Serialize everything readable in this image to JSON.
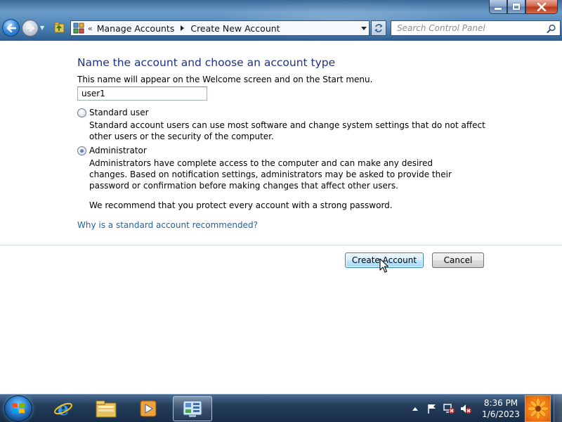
{
  "window": {
    "breadcrumb": {
      "overflow_glyph": "«",
      "items": [
        "Manage Accounts",
        "Create New Account"
      ]
    },
    "search": {
      "placeholder": "Search Control Panel"
    },
    "controls": [
      "minimize",
      "maximize",
      "close"
    ]
  },
  "page": {
    "heading": "Name the account and choose an account type",
    "subtext": "This name will appear on the Welcome screen and on the Start menu.",
    "account_name": "user1",
    "options": {
      "standard": {
        "label": "Standard user",
        "description": "Standard account users can use most software and change system settings that do not affect other users or the security of the computer.",
        "selected": false
      },
      "administrator": {
        "label": "Administrator",
        "description": "Administrators have complete access to the computer and can make any desired changes. Based on notification settings, administrators may be asked to provide their password or confirmation before making changes that affect other users.",
        "selected": true
      }
    },
    "recommendation": "We recommend that you protect every account with a strong password.",
    "help_link": "Why is a standard account recommended?",
    "buttons": {
      "create": "Create Account",
      "cancel": "Cancel"
    }
  },
  "taskbar": {
    "items": [
      "internet-explorer",
      "windows-explorer",
      "media-player",
      "control-panel"
    ],
    "active_item": "control-panel",
    "clock": {
      "time": "8:36 PM",
      "date": "1/6/2023"
    }
  },
  "colors": {
    "heading": "#1e3287",
    "link": "#1f63a8",
    "primary_button": "#bee6fd"
  }
}
